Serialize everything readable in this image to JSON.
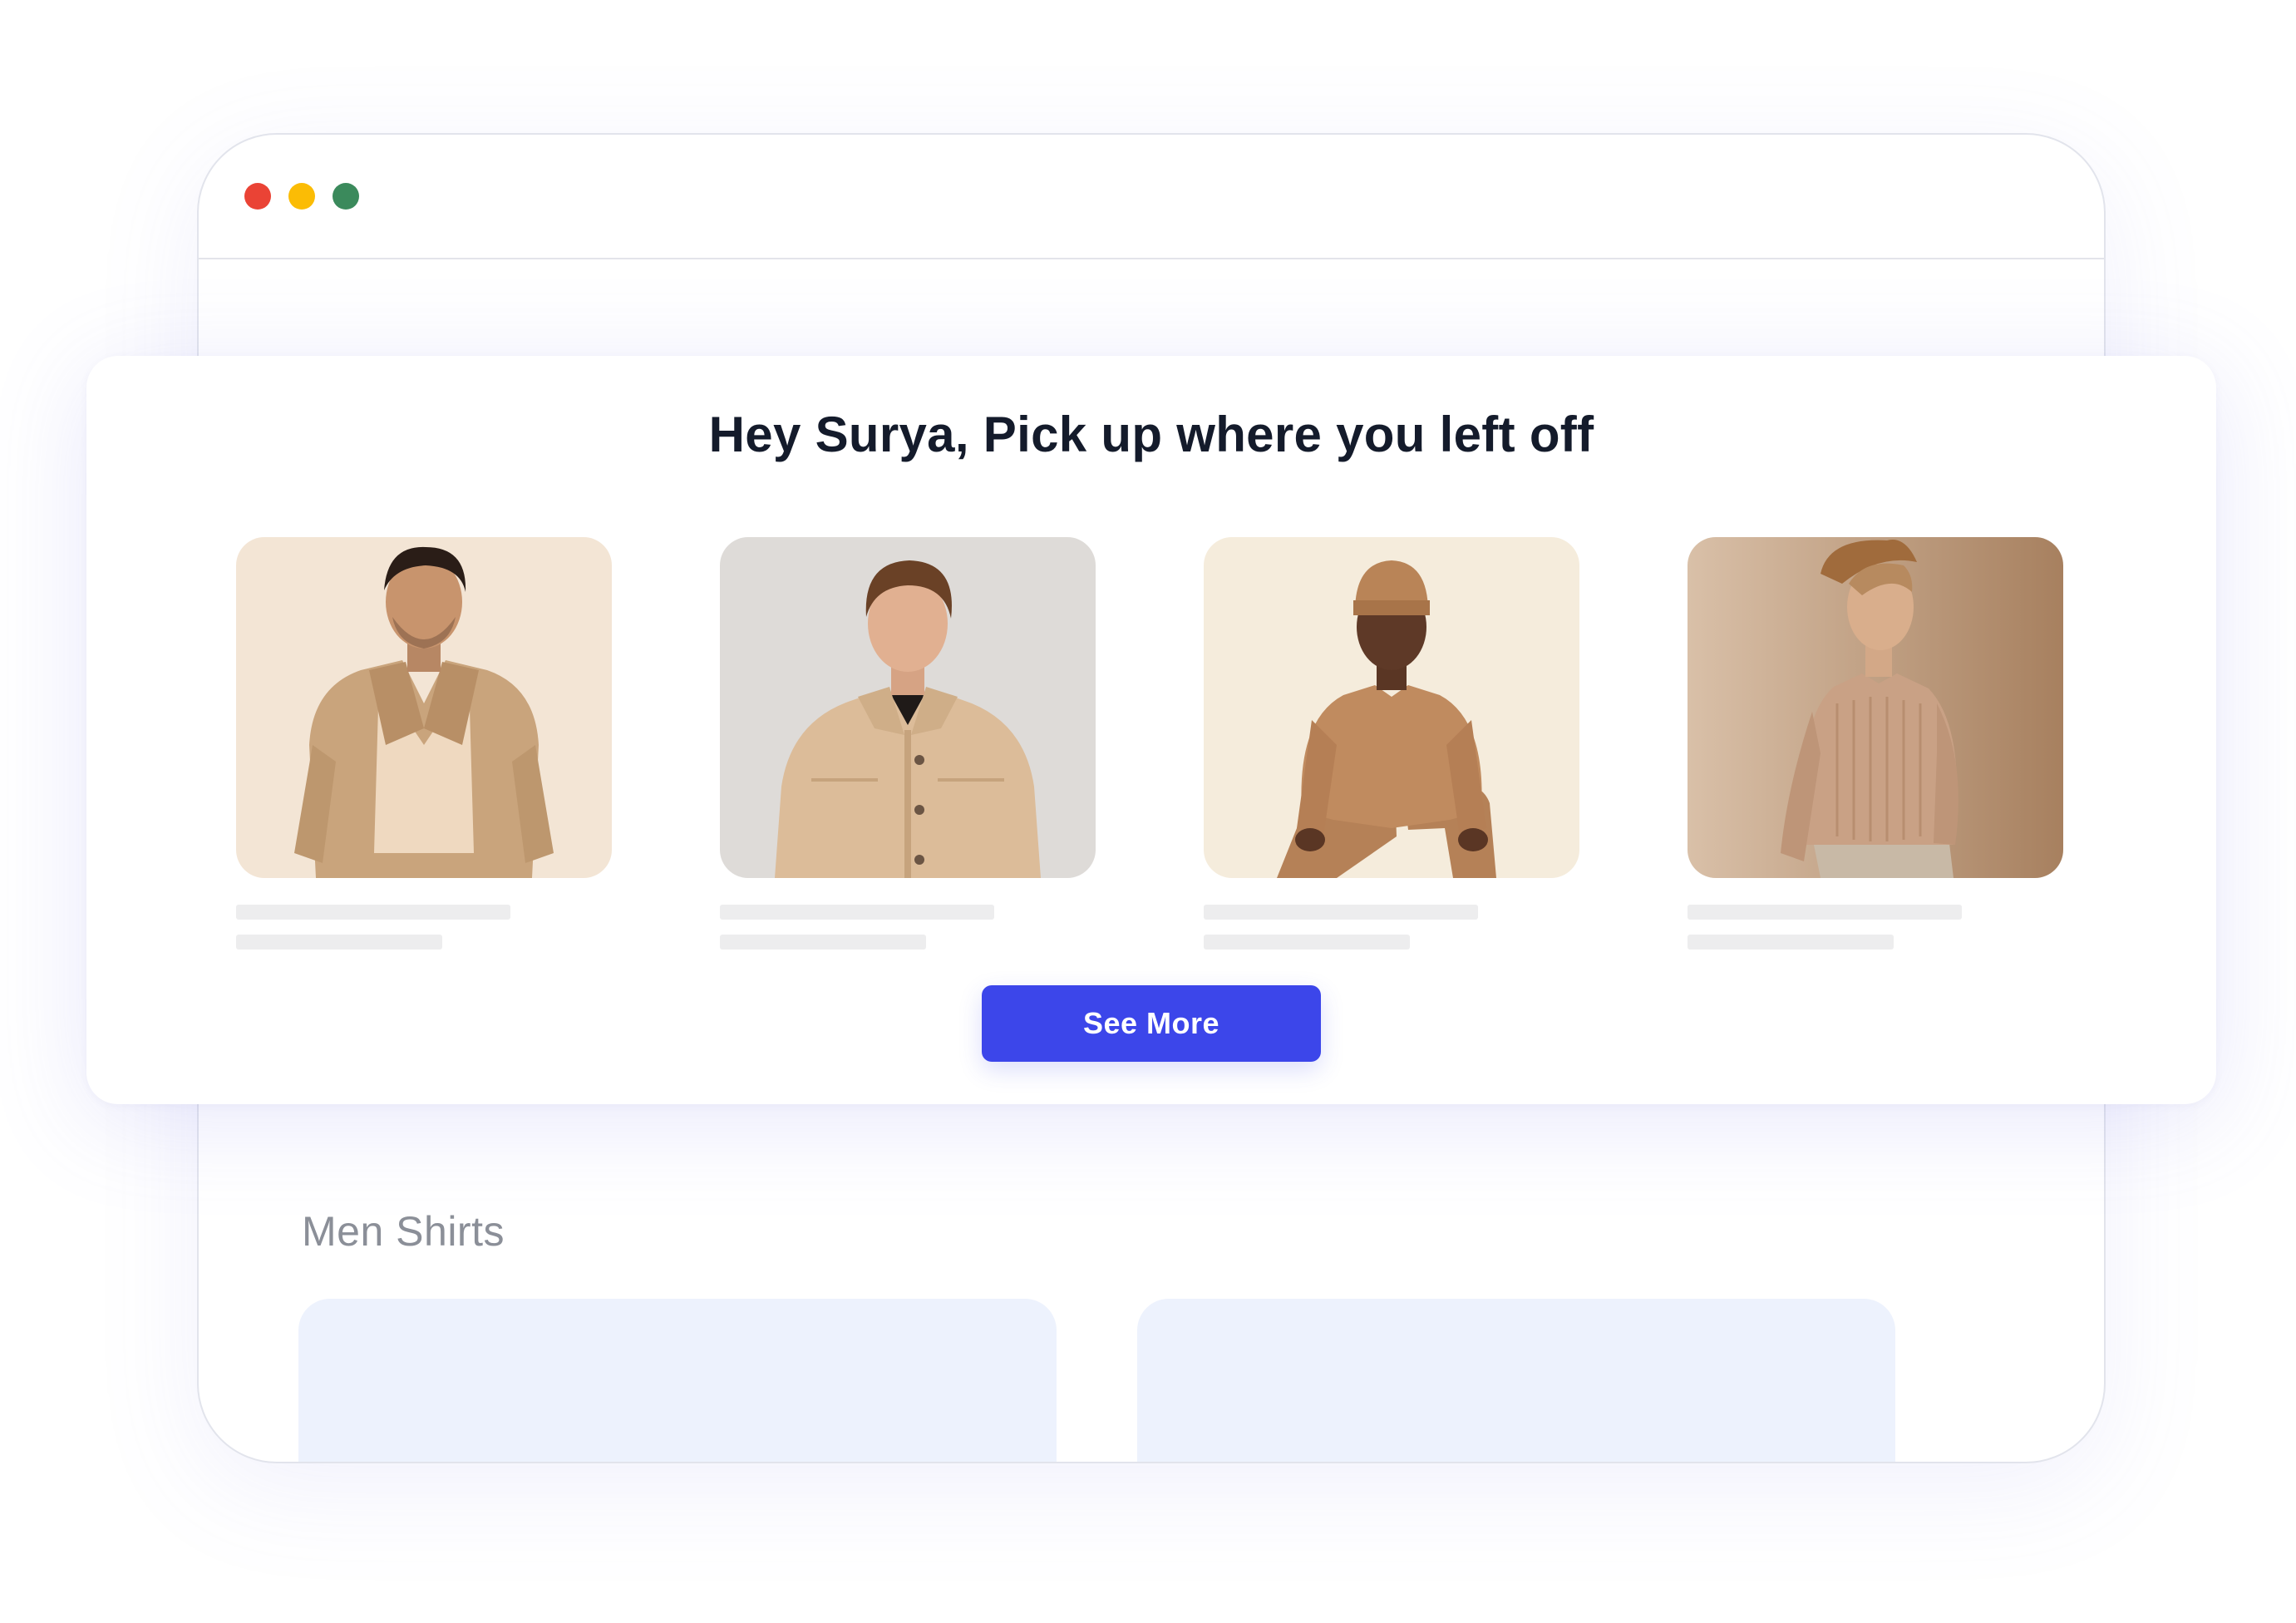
{
  "window": {
    "controls": {
      "close_color": "#ea4335",
      "minimize_color": "#fbbc05",
      "maximize_color": "#3b8a5c"
    }
  },
  "recommendations": {
    "heading": "Hey Surya, Pick up where you left off",
    "products": [
      {
        "image": "man-in-beige-blazer",
        "background": "#f2e4d4"
      },
      {
        "image": "man-in-beige-shirt-jacket",
        "background": "#dcd9d6"
      },
      {
        "image": "man-in-tan-sweater-crouching",
        "background": "#f4ead9"
      },
      {
        "image": "man-in-knit-sweater-with-hat",
        "background": "#cbae95"
      }
    ],
    "see_more_label": "See More",
    "accent_color": "#3c46ea"
  },
  "section": {
    "title": "Men Shirts"
  }
}
